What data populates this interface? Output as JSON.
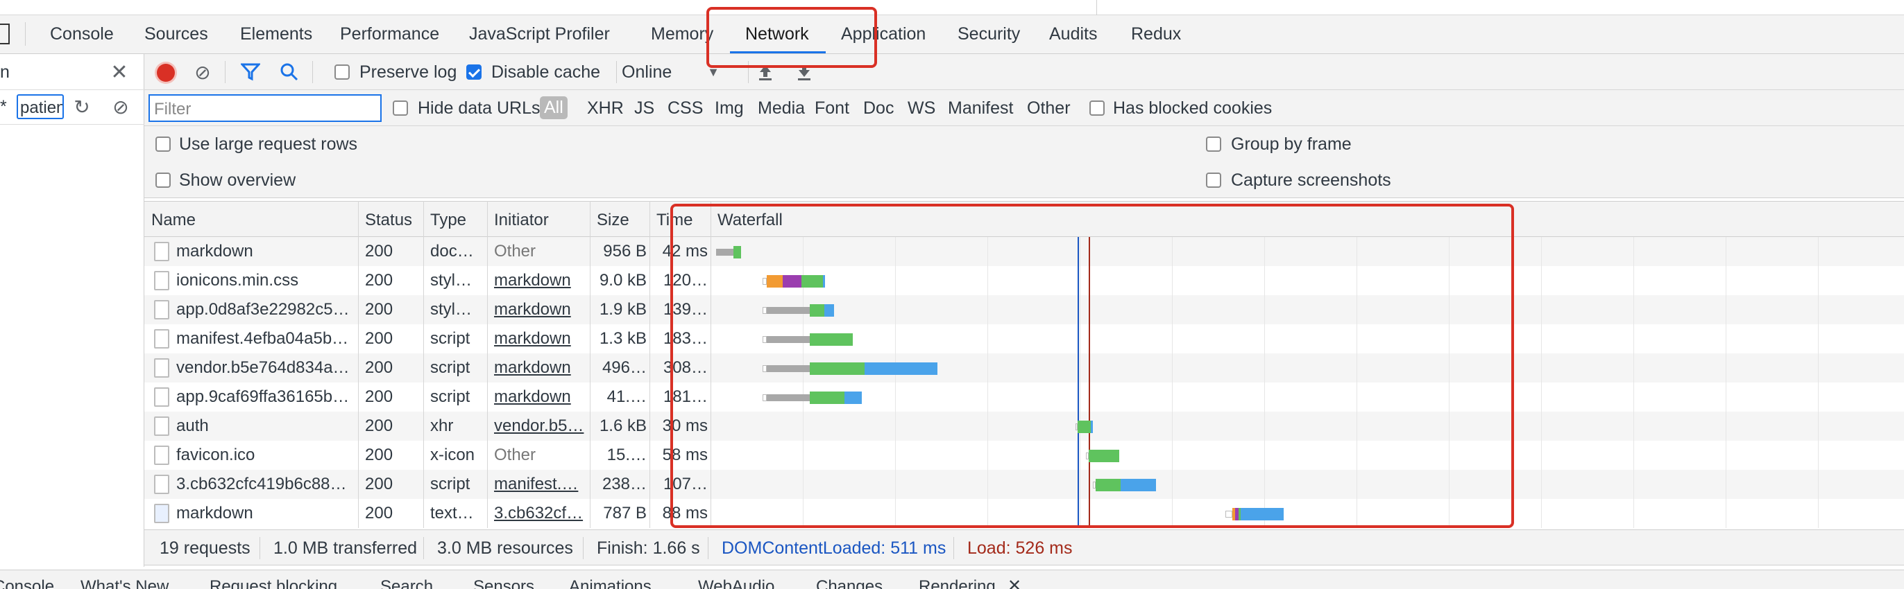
{
  "tabs": {
    "items": [
      "Console",
      "Sources",
      "Elements",
      "Performance",
      "JavaScript Profiler",
      "Memory",
      "Network",
      "Application",
      "Security",
      "Audits",
      "Redux"
    ],
    "active": "Network"
  },
  "left_panel": {
    "search_value": "n",
    "asterisk": "*",
    "filter_value": "patien"
  },
  "toolbar": {
    "preserve_log": "Preserve log",
    "disable_cache": "Disable cache",
    "throttling": "Online"
  },
  "filter_bar": {
    "placeholder": "Filter",
    "hide_data_urls": "Hide data URLs",
    "types": [
      "All",
      "XHR",
      "JS",
      "CSS",
      "Img",
      "Media",
      "Font",
      "Doc",
      "WS",
      "Manifest",
      "Other"
    ],
    "active_type": "All",
    "has_blocked_cookies": "Has blocked cookies"
  },
  "options": {
    "large_rows": "Use large request rows",
    "group_by_frame": "Group by frame",
    "show_overview": "Show overview",
    "capture_screenshots": "Capture screenshots"
  },
  "table": {
    "columns": [
      "Name",
      "Status",
      "Type",
      "Initiator",
      "Size",
      "Time",
      "Waterfall"
    ],
    "rows": [
      {
        "name": "markdown",
        "status": "200",
        "type": "doc…",
        "initiator": "Other",
        "initiator_link": false,
        "size": "956 B",
        "time": "42 ms"
      },
      {
        "name": "ionicons.min.css",
        "status": "200",
        "type": "styl…",
        "initiator": "markdown",
        "initiator_link": true,
        "size": "9.0 kB",
        "time": "120…"
      },
      {
        "name": "app.0d8af3e22982c5…",
        "status": "200",
        "type": "styl…",
        "initiator": "markdown",
        "initiator_link": true,
        "size": "1.9 kB",
        "time": "139…"
      },
      {
        "name": "manifest.4efba04a5b…",
        "status": "200",
        "type": "script",
        "initiator": "markdown",
        "initiator_link": true,
        "size": "1.3 kB",
        "time": "183…"
      },
      {
        "name": "vendor.b5e764d834a…",
        "status": "200",
        "type": "script",
        "initiator": "markdown",
        "initiator_link": true,
        "size": "496…",
        "time": "308…"
      },
      {
        "name": "app.9caf69ffa36165b…",
        "status": "200",
        "type": "script",
        "initiator": "markdown",
        "initiator_link": true,
        "size": "41.…",
        "time": "181…"
      },
      {
        "name": "auth",
        "status": "200",
        "type": "xhr",
        "initiator": "vendor.b5…",
        "initiator_link": true,
        "size": "1.6 kB",
        "time": "30 ms"
      },
      {
        "name": "favicon.ico",
        "status": "200",
        "type": "x-icon",
        "initiator": "Other",
        "initiator_link": false,
        "size": "15.…",
        "time": "58 ms"
      },
      {
        "name": "3.cb632cfc419b6c88…",
        "status": "200",
        "type": "script",
        "initiator": "manifest.…",
        "initiator_link": true,
        "size": "238…",
        "time": "107…"
      },
      {
        "name": "markdown",
        "status": "200",
        "type": "text…",
        "initiator": "3.cb632cf…",
        "initiator_link": true,
        "size": "787 B",
        "time": "88 ms"
      }
    ]
  },
  "status_bar": {
    "requests": "19 requests",
    "transferred": "1.0 MB transferred",
    "resources": "3.0 MB resources",
    "finish": "Finish: 1.66 s",
    "dom_content_loaded": "DOMContentLoaded: 511 ms",
    "load": "Load: 526 ms"
  },
  "drawer_tabs": [
    "Console",
    "What's New",
    "Request blocking",
    "Search",
    "Sensors",
    "Animations",
    "WebAudio",
    "Changes",
    "Rendering"
  ],
  "colors": {
    "waiting": "#a8a8a8",
    "download": "#5fc35e",
    "content": "#4aa3ea",
    "ssl": "#9b3eaf",
    "dns": "#f29b33",
    "dcl_line": "#1a56c2",
    "load_line": "#a32a1a",
    "highlight": "#d93025"
  }
}
